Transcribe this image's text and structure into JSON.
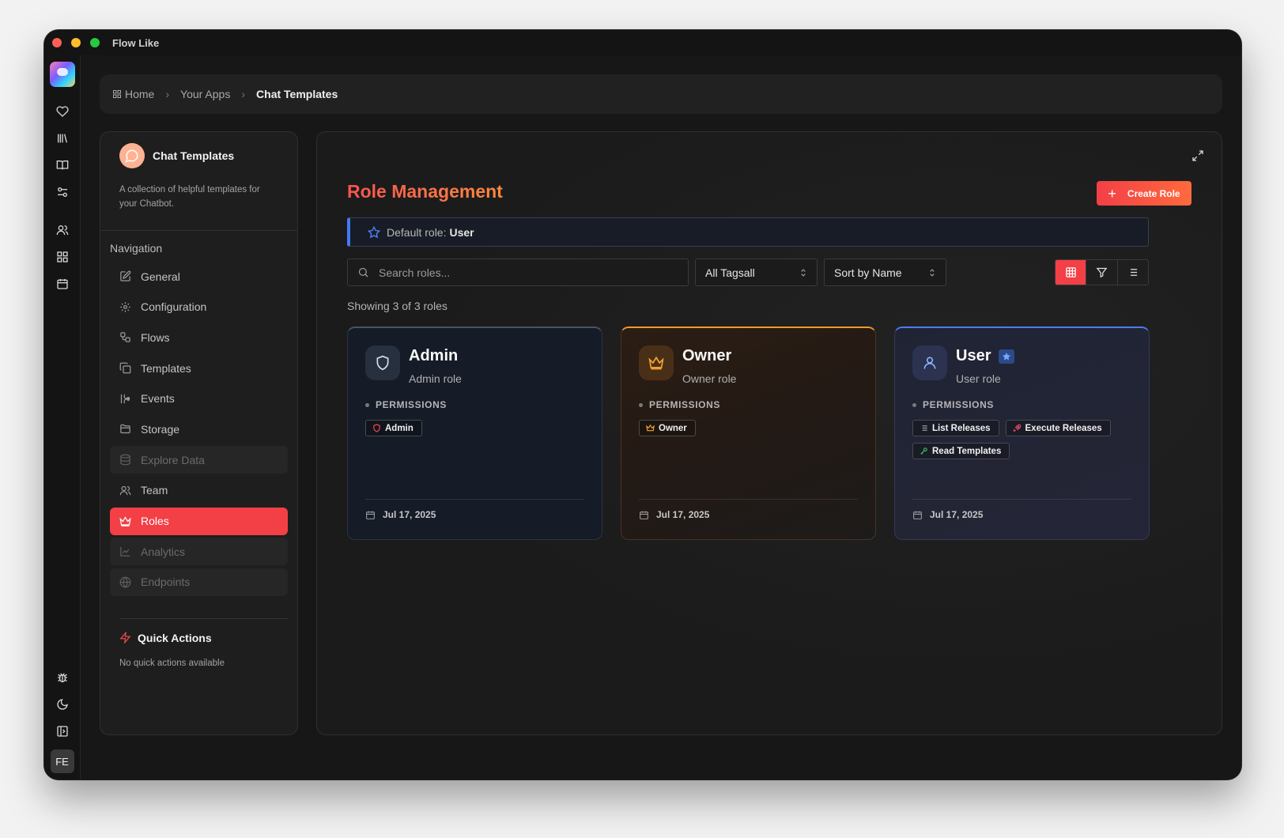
{
  "window": {
    "title": "Flow Like"
  },
  "rail": {
    "icons": [
      "heart-icon",
      "library-icon",
      "book-icon",
      "settings-sliders-icon",
      "users-icon",
      "grid-icon",
      "calendar-icon",
      "bug-icon",
      "moon-icon",
      "panel-icon"
    ],
    "avatar_initials": "FE"
  },
  "breadcrumb": {
    "items": [
      {
        "label": "Home"
      },
      {
        "label": "Your Apps"
      },
      {
        "label": "Chat Templates"
      }
    ]
  },
  "sidebar": {
    "app_name": "Chat Templates",
    "app_description": "A collection of helpful templates for your Chatbot.",
    "nav_title": "Navigation",
    "items": [
      {
        "label": "General",
        "state": "normal"
      },
      {
        "label": "Configuration",
        "state": "normal"
      },
      {
        "label": "Flows",
        "state": "normal"
      },
      {
        "label": "Templates",
        "state": "normal"
      },
      {
        "label": "Events",
        "state": "normal"
      },
      {
        "label": "Storage",
        "state": "normal"
      },
      {
        "label": "Explore Data",
        "state": "disabled"
      },
      {
        "label": "Team",
        "state": "normal"
      },
      {
        "label": "Roles",
        "state": "active"
      },
      {
        "label": "Analytics",
        "state": "disabled"
      },
      {
        "label": "Endpoints",
        "state": "disabled"
      }
    ],
    "quick_actions_title": "Quick Actions",
    "quick_actions_empty": "No quick actions available"
  },
  "main": {
    "title": "Role Management",
    "create_button": "Create Role",
    "default_role_label": "Default role:",
    "default_role_value": "User",
    "search_placeholder": "Search roles...",
    "tags_filter": "All Tagsall",
    "sort": "Sort by Name",
    "view_modes": [
      "grid-view",
      "filter",
      "list-view"
    ],
    "active_view": "grid-view",
    "showing": "Showing 3 of 3 roles",
    "roles": [
      {
        "name": "Admin",
        "description": "Admin role",
        "permissions_label": "PERMISSIONS",
        "permissions": [
          {
            "label": "Admin",
            "icon": "shield-icon",
            "color": "#f34b4b"
          }
        ],
        "date": "Jul 17, 2025",
        "accent": "#4a5364"
      },
      {
        "name": "Owner",
        "description": "Owner role",
        "permissions_label": "PERMISSIONS",
        "permissions": [
          {
            "label": "Owner",
            "icon": "crown-icon",
            "color": "#f5a52e"
          }
        ],
        "date": "Jul 17, 2025",
        "accent": "#f09a2e"
      },
      {
        "name": "User",
        "description": "User role",
        "is_default": true,
        "permissions_label": "PERMISSIONS",
        "permissions": [
          {
            "label": "List Releases",
            "icon": "list-icon",
            "color": "#9a9a9a"
          },
          {
            "label": "Execute Releases",
            "icon": "rocket-icon",
            "color": "#f34b6b"
          },
          {
            "label": "Read Templates",
            "icon": "key-icon",
            "color": "#3fbf5a"
          }
        ],
        "date": "Jul 17, 2025",
        "accent": "#4a7df0"
      }
    ]
  },
  "colors": {
    "accent": "#f33f46",
    "accent_gradient_end": "#ff6a3d",
    "info_blue": "#3f7bf5"
  }
}
